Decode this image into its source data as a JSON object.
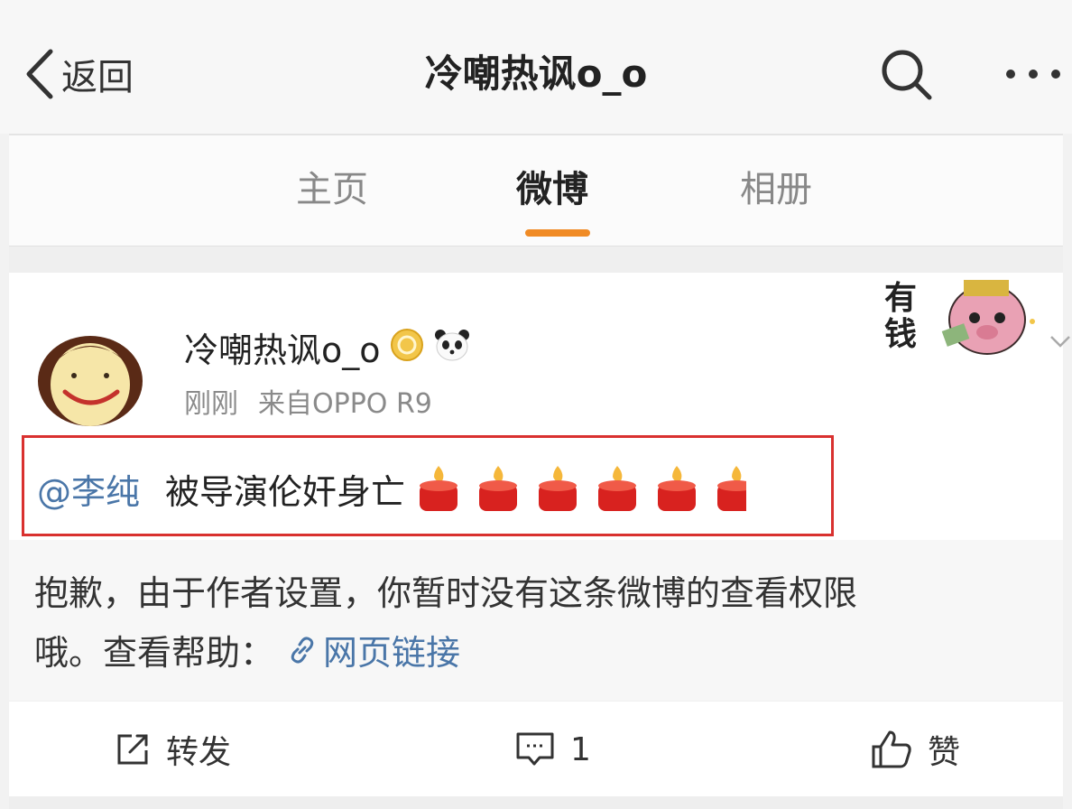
{
  "header": {
    "back_label": "返回",
    "title": "冷嘲热讽o_o"
  },
  "tabs": [
    {
      "label": "主页",
      "active": false
    },
    {
      "label": "微博",
      "active": true
    },
    {
      "label": "相册",
      "active": false
    }
  ],
  "accent_color": "#f08b25",
  "highlight_border_color": "#d9312f",
  "post": {
    "username": "冷嘲热讽o_o",
    "badges": [
      "gold-medal-icon",
      "panda-icon"
    ],
    "time": "刚刚",
    "source": "来自OPPO R9",
    "mention": "@李纯",
    "text": "被导演伦奸身亡",
    "candle_icons": [
      "candle-icon",
      "candle-icon",
      "candle-icon",
      "candle-icon",
      "candle-icon",
      "candle-icon"
    ]
  },
  "sticker": {
    "text_top": "有",
    "text_bottom": "钱"
  },
  "notice": {
    "line1": "抱歉，由于作者设置，你暂时没有这条微博的查看权限",
    "line2_prefix": "哦。查看帮助：",
    "link_label": "网页链接"
  },
  "actions": {
    "repost_label": "转发",
    "comment_count": "1",
    "like_label": "赞"
  }
}
